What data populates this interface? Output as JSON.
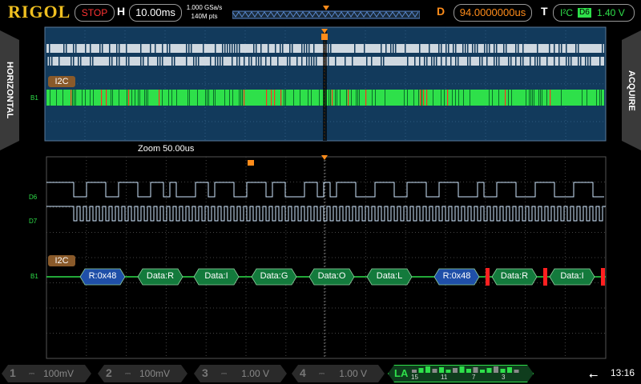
{
  "brand": "RIGOL",
  "run_state": "STOP",
  "horizontal": {
    "label": "H",
    "timebase": "10.00ms",
    "sample_rate": "1.000 GSa/s",
    "memory_depth": "140M pts"
  },
  "delay": {
    "label": "D",
    "value": "94.0000000us"
  },
  "trigger": {
    "label": "T",
    "protocol": "I²C",
    "source": "D6",
    "level": "1.40 V"
  },
  "side_tabs": {
    "left": "HORIZONTAL",
    "right": "ACQUIRE"
  },
  "zoom_label": "Zoom  50.00us",
  "bus_labels": {
    "main": "I2C",
    "zoom": "I2C"
  },
  "channel_labels": {
    "b1_main": "B1",
    "b1_zoom": "B1",
    "d6": "D6",
    "d7": "D7"
  },
  "decode_packets": [
    {
      "text": "R:0x48",
      "kind": "address"
    },
    {
      "text": "Data:R",
      "kind": "data"
    },
    {
      "text": "Data:I",
      "kind": "data"
    },
    {
      "text": "Data:G",
      "kind": "data"
    },
    {
      "text": "Data:O",
      "kind": "data"
    },
    {
      "text": "Data:L",
      "kind": "data"
    },
    {
      "text": "R:0x48",
      "kind": "address"
    },
    {
      "text": "Data:R",
      "kind": "data"
    },
    {
      "text": "Data:I",
      "kind": "data"
    }
  ],
  "channels": [
    {
      "num": "1",
      "value": "100mV"
    },
    {
      "num": "2",
      "value": "100mV"
    },
    {
      "num": "3",
      "value": "1.00 V"
    },
    {
      "num": "4",
      "value": "1.00 V"
    }
  ],
  "logic_analyzer": {
    "name": "LA",
    "bit_labels": [
      "15",
      "11",
      "7",
      "3"
    ]
  },
  "clock": "13:16",
  "colors": {
    "address_packet": "#1f4fa8",
    "data_packet": "#137a3c",
    "trace": "#cfe8ff",
    "bus": "#2ee04a",
    "error": "#ff2020",
    "trigger_orange": "#ff8c1a"
  }
}
